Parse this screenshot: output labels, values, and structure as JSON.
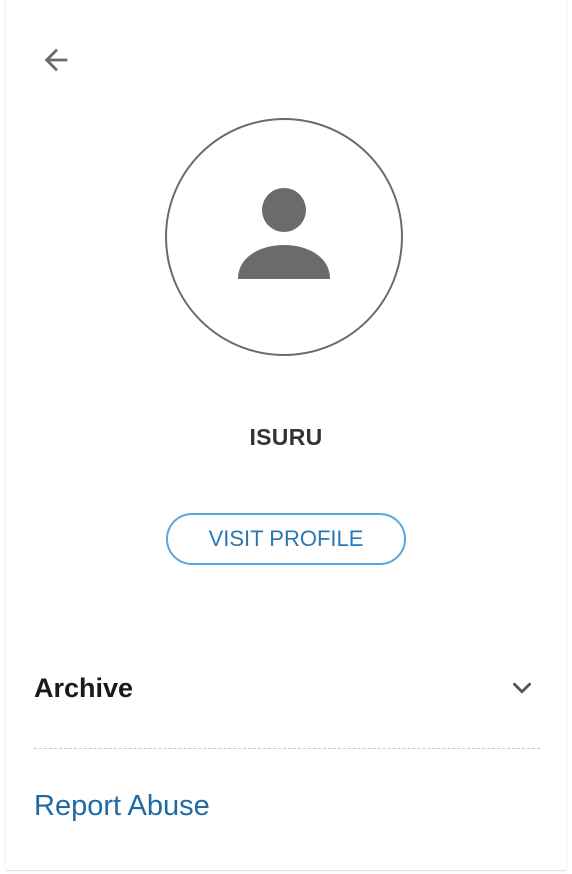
{
  "header": {
    "back_icon": "arrow-left-icon"
  },
  "profile": {
    "avatar_icon": "person-icon",
    "name": "ISURU",
    "visit_button_label": "VISIT PROFILE"
  },
  "menu": {
    "archive_label": "Archive",
    "archive_icon": "chevron-down-icon",
    "report_label": "Report Abuse"
  },
  "colors": {
    "accent_border": "#56a8df",
    "link": "#1f6aa5",
    "icon_gray": "#6b6b6b"
  }
}
